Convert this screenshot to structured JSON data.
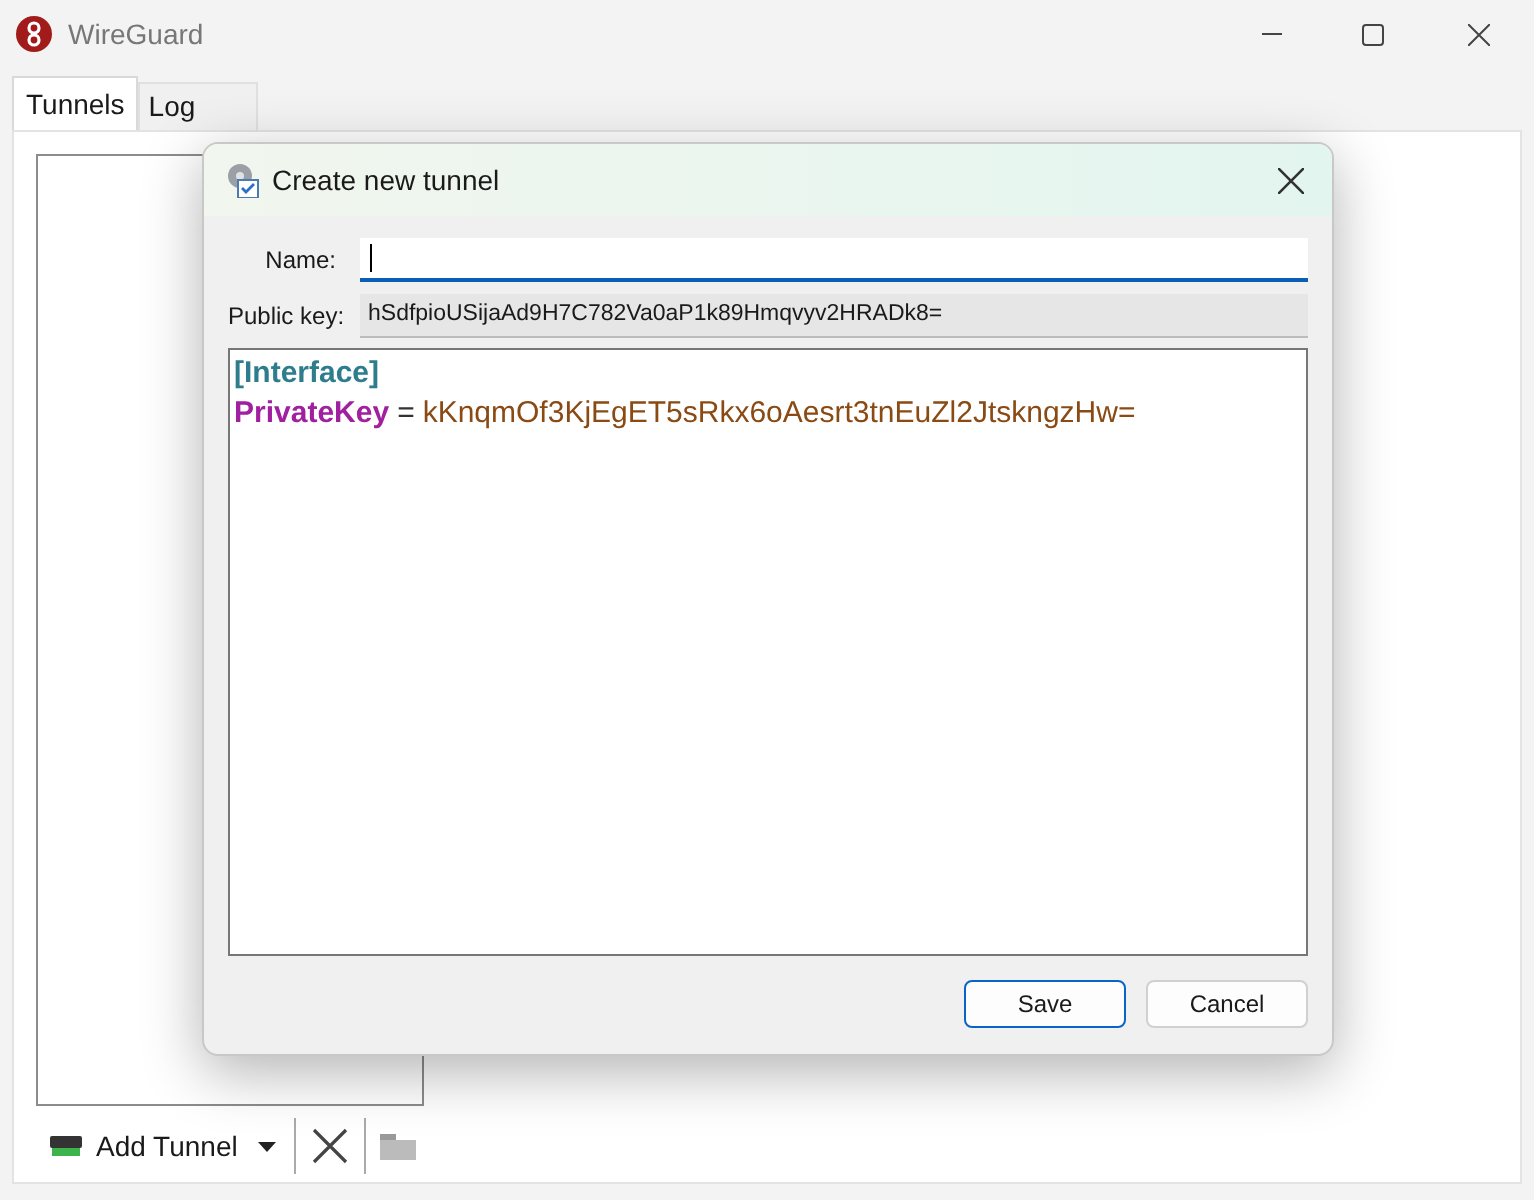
{
  "window": {
    "title": "WireGuard"
  },
  "tabs": [
    {
      "label": "Tunnels",
      "selected": true
    },
    {
      "label": "Log",
      "selected": false
    }
  ],
  "toolbar": {
    "add_button": "Add Tunnel"
  },
  "dialog": {
    "title": "Create new tunnel",
    "fields": [
      {
        "kind": "input",
        "label": "Name:",
        "focused": true
      },
      {
        "kind": "readonly",
        "label": "Public key:",
        "value": "hSdfpioUSijaAd9H7C782Va0aP1k89Hmqvyv2HRADk8="
      }
    ],
    "editor_lines": [
      [
        {
          "kind": "section",
          "text": "[Interface]"
        }
      ],
      [
        {
          "kind": "key",
          "text": "PrivateKey"
        },
        {
          "kind": "operator",
          "text": "="
        },
        {
          "kind": "value",
          "text": "kKnqmOf3KjEgET5sRkx6oAesrt3tnEuZl2JtskngzHw="
        }
      ]
    ],
    "buttons": [
      {
        "label": "Save",
        "default": true
      },
      {
        "label": "Cancel",
        "default": false
      }
    ]
  }
}
